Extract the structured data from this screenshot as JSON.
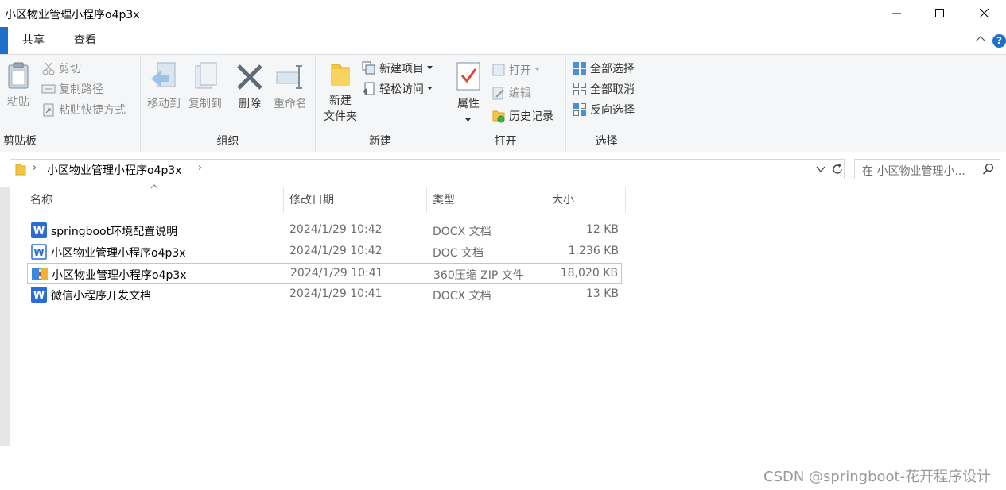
{
  "window": {
    "title": "小区物业管理小程序o4p3x"
  },
  "ribbon_tabs": [
    "共享",
    "查看"
  ],
  "help_label": "?",
  "ribbon": {
    "clipboard": {
      "label": "剪贴板",
      "paste": "粘贴",
      "cut": "剪切",
      "copy_path": "复制路径",
      "paste_shortcut": "粘贴快捷方式"
    },
    "organize": {
      "label": "组织",
      "move_to": "移动到",
      "copy_to": "复制到",
      "delete": "删除",
      "rename": "重命名"
    },
    "new": {
      "label": "新建",
      "new_folder_line1": "新建",
      "new_folder_line2": "文件夹",
      "new_item": "新建项目",
      "easy_access": "轻松访问"
    },
    "open": {
      "label": "打开",
      "properties": "属性",
      "open": "打开",
      "edit": "编辑",
      "history": "历史记录"
    },
    "select": {
      "label": "选择",
      "select_all": "全部选择",
      "select_none": "全部取消",
      "invert": "反向选择"
    }
  },
  "address": {
    "path": "小区物业管理小程序o4p3x",
    "search_placeholder": "在 小区物业管理小..."
  },
  "columns": [
    "名称",
    "修改日期",
    "类型",
    "大小"
  ],
  "files": [
    {
      "name": "springboot环境配置说明",
      "date": "2024/1/29 10:42",
      "type": "DOCX 文档",
      "size": "12 KB",
      "icon": "word-docx-icon"
    },
    {
      "name": "小区物业管理小程序o4p3x",
      "date": "2024/1/29 10:42",
      "type": "DOC 文档",
      "size": "1,236 KB",
      "icon": "word-doc-icon"
    },
    {
      "name": "小区物业管理小程序o4p3x",
      "date": "2024/1/29 10:41",
      "type": "360压缩 ZIP 文件",
      "size": "18,020 KB",
      "icon": "zip-archive-icon"
    },
    {
      "name": "微信小程序开发文档",
      "date": "2024/1/29 10:41",
      "type": "DOCX 文档",
      "size": "13 KB",
      "icon": "word-docx-icon"
    }
  ],
  "watermark": "CSDN @springboot-花开程序设计",
  "colors": {
    "accent": "#1e6fc9",
    "selection_border": "#99d1ff",
    "ribbon_bg": "#f5f6f7"
  }
}
